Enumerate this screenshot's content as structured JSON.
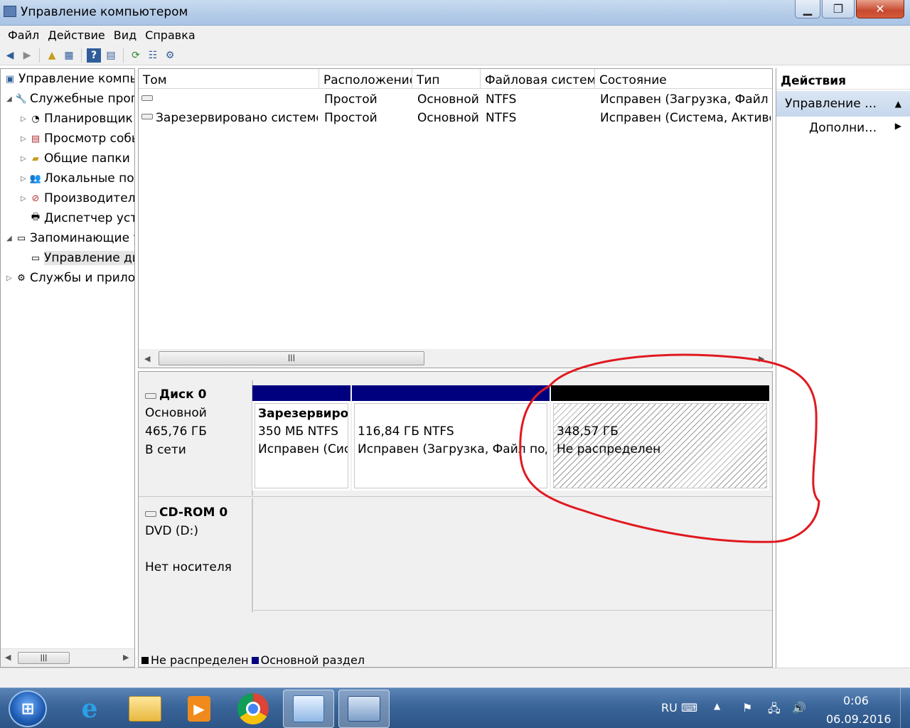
{
  "window": {
    "title": "Управление компьютером"
  },
  "menu": [
    "Файл",
    "Действие",
    "Вид",
    "Справка"
  ],
  "tree": {
    "items": [
      {
        "label": "Управление компьютером (локальным)",
        "depth": 0,
        "expander": ""
      },
      {
        "label": "Служебные программы",
        "depth": 1,
        "expander": "◢"
      },
      {
        "label": "Планировщик заданий",
        "depth": 2,
        "expander": "▷"
      },
      {
        "label": "Просмотр событий",
        "depth": 2,
        "expander": "▷"
      },
      {
        "label": "Общие папки",
        "depth": 2,
        "expander": "▷"
      },
      {
        "label": "Локальные пользователи",
        "depth": 2,
        "expander": "▷"
      },
      {
        "label": "Производительность",
        "depth": 2,
        "expander": "▷"
      },
      {
        "label": "Диспетчер устройств",
        "depth": 2,
        "expander": ""
      },
      {
        "label": "Запоминающие устройства",
        "depth": 1,
        "expander": "◢"
      },
      {
        "label": "Управление дисками",
        "depth": 2,
        "expander": ""
      },
      {
        "label": "Службы и приложения",
        "depth": 1,
        "expander": "▷"
      }
    ]
  },
  "volumes": {
    "columns": [
      "Том",
      "Расположение",
      "Тип",
      "Файловая система",
      "Состояние"
    ],
    "rows": [
      [
        "",
        "Простой",
        "Основной",
        "NTFS",
        "Исправен (Загрузка, Файл подкачки, Аварийный дамп, Основной раздел)"
      ],
      [
        "Зарезервировано системой",
        "Простой",
        "Основной",
        "NTFS",
        "Исправен (Система, Активен, Основной раздел)"
      ]
    ]
  },
  "disks": [
    {
      "name": "Диск 0",
      "type": "Основной",
      "size": "465,76 ГБ",
      "status": "В сети",
      "partitions": [
        {
          "title": "Зарезервировано системой",
          "size": "350 МБ NTFS",
          "state": "Исправен (Система, Активен, Основной раздел)",
          "color": "#00007f"
        },
        {
          "title": "",
          "size": "116,84 ГБ NTFS",
          "state": "Исправен (Загрузка, Файл подкачки, Аварийный дамп, Основной раздел)",
          "color": "#00007f"
        },
        {
          "title": "",
          "size": "348,57 ГБ",
          "state": "Не распределен",
          "color": "#000000"
        }
      ]
    },
    {
      "name": "CD-ROM 0",
      "type": "DVD (D:)",
      "size": "",
      "status": "Нет носителя",
      "partitions": []
    }
  ],
  "legend": [
    {
      "label": "Не распределен",
      "color": "#000000"
    },
    {
      "label": "Основной раздел",
      "color": "#00007f"
    }
  ],
  "actions": {
    "title": "Действия",
    "section": "Управление дисками",
    "more": "Дополнительные действия"
  },
  "tray": {
    "lang": "RU",
    "time": "0:06",
    "date": "06.09.2016"
  },
  "annotation": {
    "color": "#e0191f",
    "shape": "hand-drawn-circle"
  }
}
